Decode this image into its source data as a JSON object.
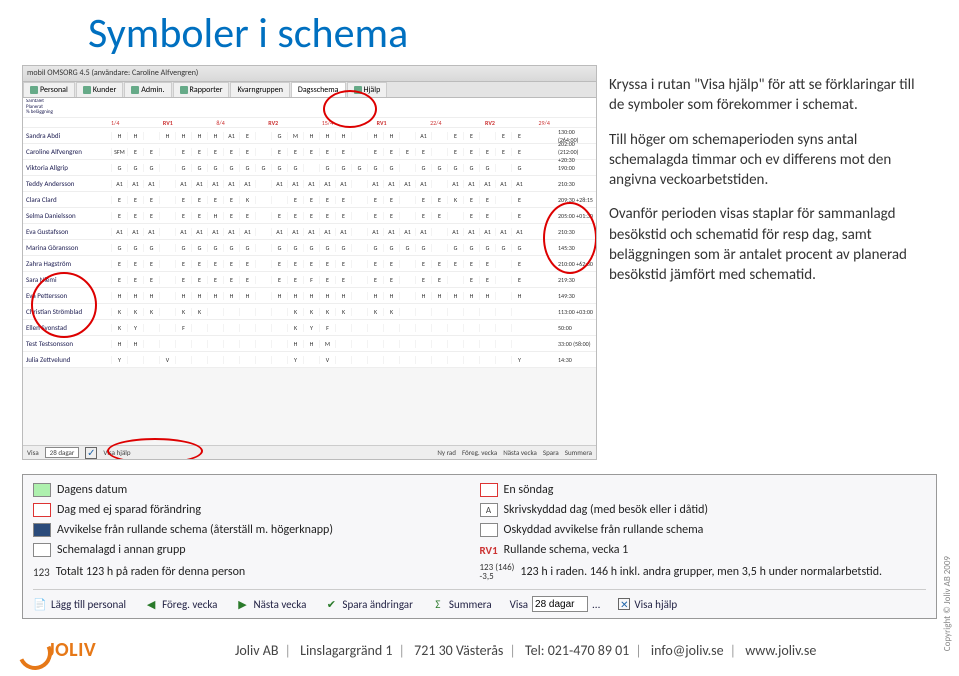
{
  "title": "Symboler i schema",
  "schema": {
    "window_title": "mobil OMSORG 4.5 (användare: Caroline Alfvengren)",
    "tabs": [
      "Personal",
      "Kunder",
      "Admin.",
      "Rapporter",
      "Kvarngruppen",
      "Dagsschema",
      "Hjälp"
    ],
    "header_labels": [
      "Samtalet",
      "Planerat",
      "% beläggning"
    ],
    "week_labels": [
      "1/4",
      "RV1",
      "8/4",
      "RV2",
      "15/4",
      "RV1",
      "22/4",
      "RV2",
      "29/4"
    ],
    "rows": [
      {
        "name": "Sandra Abdi",
        "cells": [
          "H",
          "H",
          "",
          "H",
          "H",
          "H",
          "H",
          "A1",
          "E",
          "",
          "G",
          "M",
          "H",
          "H",
          "H",
          "",
          "H",
          "H",
          "",
          "A1",
          "",
          "E",
          "E",
          "",
          "E",
          "E"
        ],
        "right": "130:00 (264:00)"
      },
      {
        "name": "Caroline Alfvengren",
        "cells": [
          "SFM",
          "E",
          "E",
          "",
          "E",
          "E",
          "E",
          "E",
          "E",
          "",
          "E",
          "E",
          "E",
          "E",
          "E",
          "",
          "E",
          "E",
          "E",
          "E",
          "",
          "E",
          "E",
          "E",
          "E",
          "E"
        ],
        "right": "202:00 (212:00) +20:30"
      },
      {
        "name": "Viktoria Allgrip",
        "cells": [
          "G",
          "G",
          "G",
          "",
          "G",
          "G",
          "G",
          "G",
          "G",
          "G",
          "G",
          "G",
          "",
          "G",
          "G",
          "G",
          "G",
          "G",
          "",
          "G",
          "G",
          "G",
          "G",
          "G",
          "",
          "G"
        ],
        "right": "190:00"
      },
      {
        "name": "Teddy Andersson",
        "cells": [
          "A1",
          "A1",
          "A1",
          "",
          "A1",
          "A1",
          "A1",
          "A1",
          "A1",
          "",
          "A1",
          "A1",
          "A1",
          "A1",
          "A1",
          "",
          "A1",
          "A1",
          "A1",
          "A1",
          "",
          "A1",
          "A1",
          "A1",
          "A1",
          "A1"
        ],
        "right": "210:30"
      },
      {
        "name": "Clara Clard",
        "cells": [
          "E",
          "E",
          "E",
          "",
          "E",
          "E",
          "E",
          "E",
          "K",
          "",
          "",
          "E",
          "E",
          "E",
          "E",
          "",
          "E",
          "E",
          "",
          "E",
          "E",
          "K",
          "E",
          "E",
          "",
          "E"
        ],
        "right": "209:30 +28:15"
      },
      {
        "name": "Selma Danielsson",
        "cells": [
          "E",
          "E",
          "E",
          "",
          "E",
          "E",
          "H",
          "E",
          "E",
          "",
          "E",
          "E",
          "E",
          "E",
          "E",
          "",
          "E",
          "E",
          "",
          "E",
          "E",
          "",
          "E",
          "E",
          "",
          "E"
        ],
        "right": "205:00 +01:30"
      },
      {
        "name": "Eva Gustafsson",
        "cells": [
          "A1",
          "A1",
          "A1",
          "",
          "A1",
          "A1",
          "A1",
          "A1",
          "A1",
          "",
          "A1",
          "A1",
          "A1",
          "A1",
          "A1",
          "",
          "A1",
          "A1",
          "A1",
          "A1",
          "",
          "A1",
          "A1",
          "A1",
          "A1",
          "A1"
        ],
        "right": "210:30"
      },
      {
        "name": "Marina Göransson",
        "cells": [
          "G",
          "G",
          "G",
          "",
          "G",
          "G",
          "G",
          "G",
          "G",
          "",
          "G",
          "G",
          "G",
          "G",
          "G",
          "",
          "G",
          "G",
          "G",
          "G",
          "",
          "G",
          "G",
          "G",
          "G",
          "G"
        ],
        "right": "145:30"
      },
      {
        "name": "Zahra Hagström",
        "cells": [
          "E",
          "E",
          "E",
          "",
          "E",
          "E",
          "E",
          "E",
          "E",
          "",
          "E",
          "E",
          "E",
          "E",
          "E",
          "",
          "E",
          "E",
          "",
          "E",
          "E",
          "E",
          "E",
          "E",
          "",
          "E"
        ],
        "right": "210:00 +62:30"
      },
      {
        "name": "Sara Niemi",
        "cells": [
          "E",
          "E",
          "E",
          "",
          "E",
          "E",
          "E",
          "E",
          "E",
          "",
          "E",
          "E",
          "F",
          "E",
          "E",
          "",
          "E",
          "E",
          "",
          "E",
          "E",
          "",
          "E",
          "E",
          "",
          "E"
        ],
        "right": "219:30"
      },
      {
        "name": "Eva Pettersson",
        "cells": [
          "H",
          "H",
          "H",
          "",
          "H",
          "H",
          "H",
          "H",
          "H",
          "",
          "H",
          "H",
          "H",
          "H",
          "H",
          "",
          "H",
          "H",
          "",
          "H",
          "H",
          "H",
          "H",
          "H",
          "",
          "H"
        ],
        "right": "149:30"
      },
      {
        "name": "Christian Strömblad",
        "cells": [
          "K",
          "K",
          "K",
          "",
          "K",
          "K",
          "",
          "",
          "",
          "",
          "",
          "K",
          "K",
          "K",
          "K",
          "",
          "K",
          "K",
          "",
          "",
          "",
          "",
          "",
          "",
          "",
          ""
        ],
        "right": "113:00 +03:00"
      },
      {
        "name": "Ellen Svonstad",
        "cells": [
          "K",
          "Y",
          "",
          "",
          "F",
          "",
          "",
          "",
          "",
          "",
          "",
          "K",
          "Y",
          "F",
          "",
          "",
          "",
          "",
          "",
          "",
          "",
          "",
          "",
          "",
          "",
          ""
        ],
        "right": "50:00"
      },
      {
        "name": "Test Testsonsson",
        "cells": [
          "H",
          "H",
          "",
          "",
          "",
          "",
          "",
          "",
          "",
          "",
          "",
          "H",
          "H",
          "M",
          "",
          "",
          "",
          "",
          "",
          "",
          "",
          "",
          "",
          "",
          "",
          ""
        ],
        "right": "33:00 (58:00)"
      },
      {
        "name": "Julia Zettvelund",
        "cells": [
          "Y",
          "",
          "",
          "V",
          "",
          "",
          "",
          "",
          "",
          "",
          "",
          "Y",
          "",
          "V",
          "",
          "",
          "",
          "",
          "",
          "",
          "",
          "",
          "",
          "",
          "",
          "Y"
        ],
        "right": "14:30"
      }
    ],
    "bottom": {
      "visa_label": "Visa",
      "visa_value": "28 dagar",
      "visa_hjalp": "Visa hjälp",
      "btns": [
        "Ny rad",
        "Föreg. vecka",
        "Nästa vecka",
        "Spara",
        "Summera"
      ]
    }
  },
  "desc": {
    "p1": "Kryssa i rutan \"Visa hjälp\" för att se förklaringar till de symboler som förekommer i schemat.",
    "p2": "Till höger om schemaperioden syns antal schemalagda timmar och ev differens mot den angivna veckoarbetstiden.",
    "p3": "Ovanför perioden visas staplar för sammanlagd besökstid och schematid för resp dag, samt beläggningen som är antalet procent av planerad besökstid jämfört med schematid."
  },
  "legend": {
    "rows": [
      {
        "l_swatch": "today",
        "l_text": "Dagens datum",
        "r_swatch": "red",
        "r_swatch_text": "",
        "r_text": "En söndag"
      },
      {
        "l_swatch": "red",
        "l_text": "Dag med ej sparad förändring",
        "r_swatch": "pale",
        "r_swatch_text": "A",
        "r_text": "Skrivskyddad dag (med besök eller i dåtid)"
      },
      {
        "l_swatch": "darkblue",
        "l_text": "Avvikelse från rullande schema (återställ m. högerknapp)",
        "r_swatch": "pale",
        "r_swatch_text": "",
        "r_text": "Oskyddad avvikelse från rullande schema"
      },
      {
        "l_swatch": "pale",
        "l_text": "Schemalagd i annan grupp",
        "r_text": "Rullande schema, vecka 1",
        "r_is_rv1": true
      },
      {
        "l_text": "Totalt 123 h på raden för denna person",
        "l_is_123": true,
        "r_text": "123 h i raden. 146 h inkl. andra grupper, men 3,5 h under normalarbetstid.",
        "r_is_123b": true,
        "r_123b": "123 (146)\n-3,5"
      }
    ],
    "toolbar": {
      "add": "Lägg till personal",
      "prev": "Föreg. vecka",
      "next": "Nästa vecka",
      "save": "Spara ändringar",
      "sum": "Summera",
      "visa": "Visa",
      "visa_value": "28 dagar",
      "ellipsis": "...",
      "visa_hjalp": "Visa hjälp"
    }
  },
  "footer": {
    "company": "JOLIV",
    "line_parts": [
      "Joliv AB",
      "Linslagargränd 1",
      "721 30 Västerås",
      "Tel: 021-470 89 01",
      "info@joliv.se",
      "www.joliv.se"
    ]
  },
  "copyright": "Copyright © Joliv AB 2009"
}
